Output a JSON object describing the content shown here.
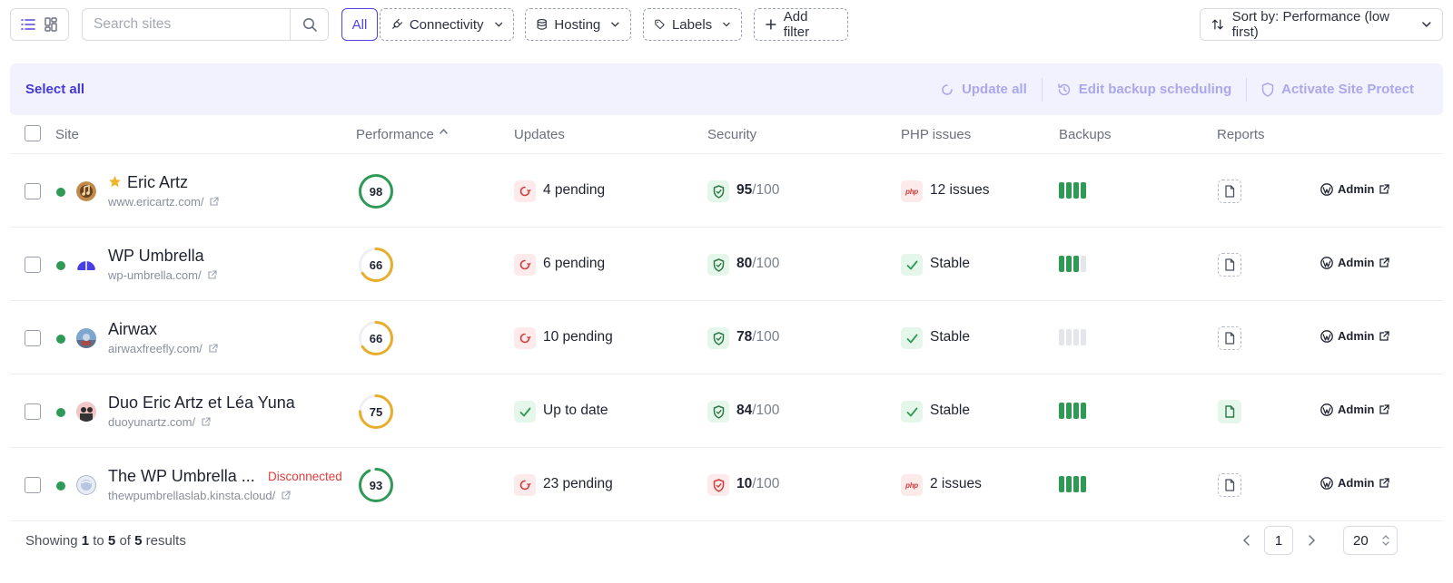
{
  "toolbar": {
    "search_placeholder": "Search sites",
    "all_label": "All",
    "filters": [
      {
        "label": "Connectivity",
        "icon": "plug-icon"
      },
      {
        "label": "Hosting",
        "icon": "database-icon"
      },
      {
        "label": "Labels",
        "icon": "tag-icon"
      }
    ],
    "add_filter_label": "Add filter",
    "sort_label": "Sort by: Performance (low first)"
  },
  "bulk": {
    "select_all": "Select all",
    "actions": [
      {
        "label": "Update all",
        "icon": "refresh-icon"
      },
      {
        "label": "Edit backup scheduling",
        "icon": "history-icon"
      },
      {
        "label": "Activate Site Protect",
        "icon": "shield-icon"
      }
    ]
  },
  "columns": {
    "site": "Site",
    "performance": "Performance",
    "updates": "Updates",
    "security": "Security",
    "php": "PHP issues",
    "backups": "Backups",
    "reports": "Reports"
  },
  "rows": [
    {
      "name": "Eric Artz",
      "favorite": true,
      "url": "www.ericartz.com/",
      "status": "",
      "performance": 98,
      "updates": "4 pending",
      "updates_state": "pending",
      "security_score": "95",
      "security_total": "/100",
      "security_state": "good",
      "php": "12 issues",
      "php_state": "issues",
      "backups": 4,
      "report_on": false,
      "admin": "Admin"
    },
    {
      "name": "WP Umbrella",
      "favorite": false,
      "url": "wp-umbrella.com/",
      "status": "",
      "performance": 66,
      "updates": "6 pending",
      "updates_state": "pending",
      "security_score": "80",
      "security_total": "/100",
      "security_state": "good",
      "php": "Stable",
      "php_state": "stable",
      "backups": 3,
      "report_on": false,
      "admin": "Admin"
    },
    {
      "name": "Airwax",
      "favorite": false,
      "url": "airwaxfreefly.com/",
      "status": "",
      "performance": 66,
      "updates": "10 pending",
      "updates_state": "pending",
      "security_score": "78",
      "security_total": "/100",
      "security_state": "good",
      "php": "Stable",
      "php_state": "stable",
      "backups": 0,
      "report_on": false,
      "admin": "Admin"
    },
    {
      "name": "Duo Eric Artz et Léa Yuna",
      "favorite": false,
      "url": "duoyunartz.com/",
      "status": "",
      "performance": 75,
      "updates": "Up to date",
      "updates_state": "ok",
      "security_score": "84",
      "security_total": "/100",
      "security_state": "good",
      "php": "Stable",
      "php_state": "stable",
      "backups": 4,
      "report_on": true,
      "admin": "Admin"
    },
    {
      "name": "The WP Umbrella ...",
      "favorite": false,
      "url": "thewpumbrellaslab.kinsta.cloud/",
      "status": "Disconnected",
      "performance": 93,
      "updates": "23 pending",
      "updates_state": "pending",
      "security_score": "10",
      "security_total": "/100",
      "security_state": "bad",
      "php": "2 issues",
      "php_state": "issues",
      "backups": 4,
      "report_on": false,
      "admin": "Admin"
    }
  ],
  "footer": {
    "showing_prefix": "Showing",
    "from": "1",
    "to_word": "to",
    "to": "5",
    "of_word": "of",
    "total": "5",
    "results_word": "results",
    "page": "1",
    "per_page": "20"
  },
  "colors": {
    "accent": "#5145e0",
    "green": "#2f9a55",
    "orange": "#e9ad2c",
    "red": "#d23c3c"
  }
}
